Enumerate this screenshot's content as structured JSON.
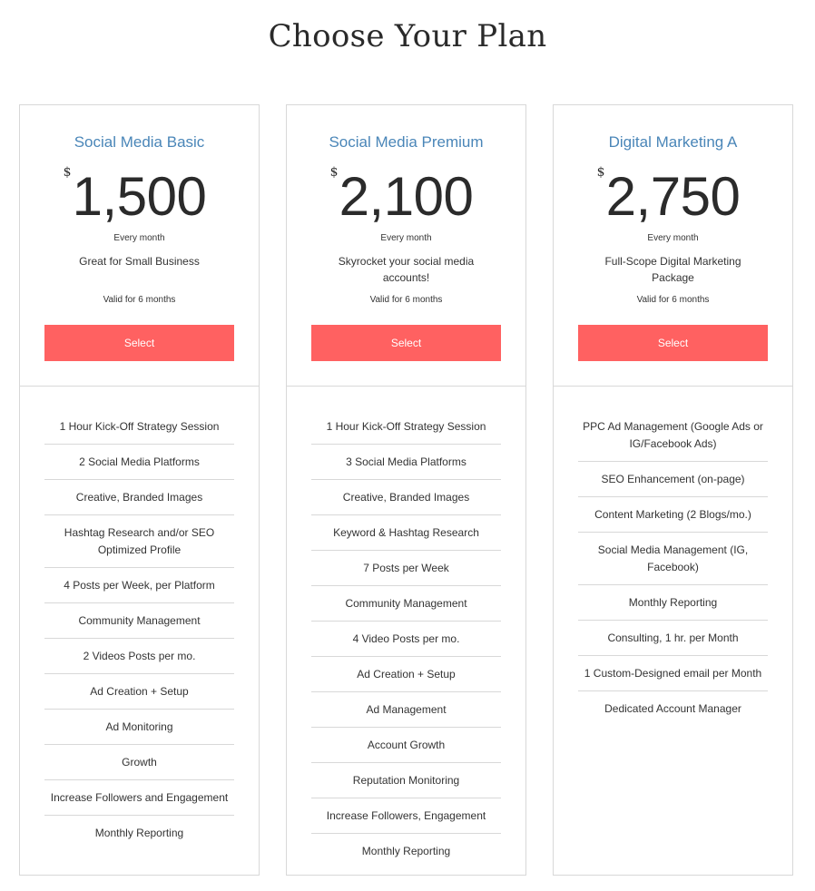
{
  "page": {
    "title": "Choose Your Plan"
  },
  "colors": {
    "accent": "#ff6161",
    "plan_name": "#4a86b8",
    "border": "#d8d8d8"
  },
  "plans": [
    {
      "name": "Social Media Basic",
      "currency": "$",
      "price": "1,500",
      "period": "Every month",
      "tagline": "Great for Small Business",
      "validity": "Valid for 6 months",
      "button_label": "Select",
      "features": [
        "1 Hour Kick-Off Strategy Session",
        "2 Social Media Platforms",
        "Creative, Branded Images",
        "Hashtag Research and/or SEO Optimized Profile",
        "4 Posts per Week, per Platform",
        "Community Management",
        "2 Videos Posts per mo.",
        "Ad Creation + Setup",
        "Ad Monitoring",
        "Growth",
        "Increase Followers and Engagement",
        "Monthly Reporting"
      ]
    },
    {
      "name": "Social Media Premium",
      "currency": "$",
      "price": "2,100",
      "period": "Every month",
      "tagline": "Skyrocket your social media accounts!",
      "validity": "Valid for 6 months",
      "button_label": "Select",
      "features": [
        "1 Hour Kick-Off Strategy Session",
        "3 Social Media Platforms",
        "Creative, Branded Images",
        "Keyword & Hashtag Research",
        "7 Posts per Week",
        "Community Management",
        "4 Video Posts per mo.",
        "Ad Creation + Setup",
        "Ad Management",
        "Account Growth",
        "Reputation Monitoring",
        "Increase Followers, Engagement",
        "Monthly Reporting"
      ]
    },
    {
      "name": "Digital Marketing A",
      "currency": "$",
      "price": "2,750",
      "period": "Every month",
      "tagline": "Full-Scope Digital Marketing Package",
      "validity": "Valid for 6 months",
      "button_label": "Select",
      "features": [
        "PPC Ad Management (Google Ads or IG/Facebook Ads)",
        "SEO Enhancement (on-page)",
        "Content Marketing (2 Blogs/mo.)",
        "Social Media Management (IG, Facebook)",
        "Monthly Reporting",
        "Consulting, 1 hr. per Month",
        "1 Custom-Designed email per Month",
        "Dedicated Account Manager"
      ]
    }
  ]
}
